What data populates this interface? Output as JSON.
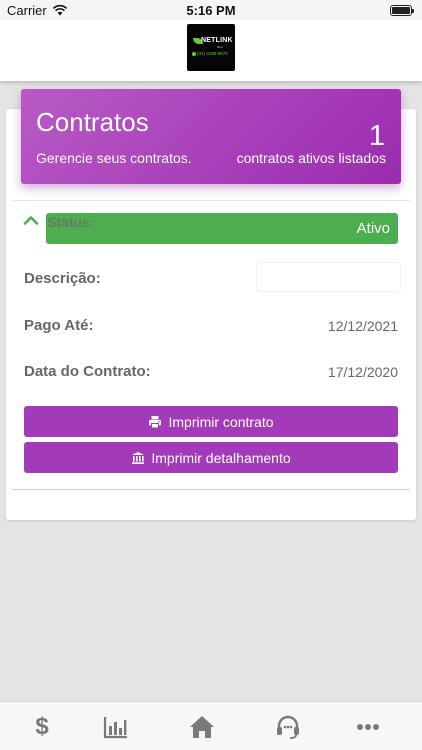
{
  "status_bar": {
    "carrier": "Carrier",
    "time": "5:16 PM"
  },
  "logo": {
    "brand": "NETLINK",
    "sub": "fibra",
    "phone": "(34) 3199-9870"
  },
  "banner": {
    "title": "Contratos",
    "subtitle": "Gerencie seus contratos.",
    "count": "1",
    "count_label": "contratos ativos listados",
    "color": "#a33ab9"
  },
  "contract": {
    "status_label": "Status:",
    "status_value": "Ativo",
    "status_color": "#4cae4f",
    "description_label": "Descrição:",
    "description_value": "",
    "paid_until_label": "Pago Até:",
    "paid_until_value": "12/12/2021",
    "contract_date_label": "Data do Contrato:",
    "contract_date_value": "17/12/2020",
    "print_contract_label": "Imprimir contrato",
    "print_detail_label": "Imprimir detalhamento"
  },
  "bottom_nav": {
    "items": [
      {
        "icon": "dollar-icon",
        "glyph": "$"
      },
      {
        "icon": "bar-chart-icon"
      },
      {
        "icon": "home-icon"
      },
      {
        "icon": "headset-icon"
      },
      {
        "icon": "more-icon"
      }
    ]
  }
}
